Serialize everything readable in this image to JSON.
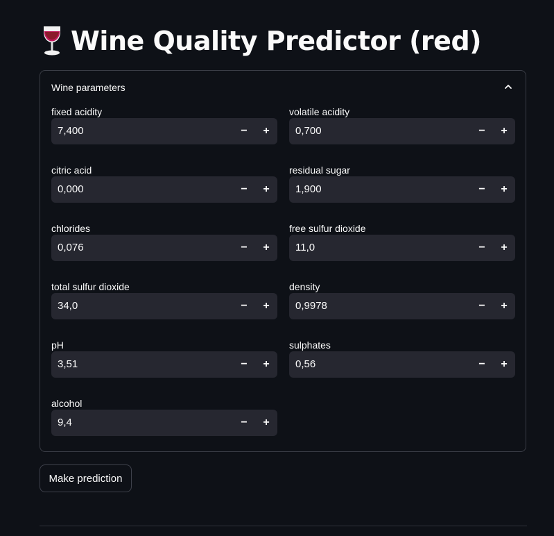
{
  "header": {
    "icon": "wine-glass-icon",
    "title": "Wine Quality Predictor (red)"
  },
  "expander": {
    "title": "Wine parameters",
    "expanded": true,
    "toggle_icon": "chevron-up-icon"
  },
  "fields": [
    {
      "label": "fixed acidity",
      "value": "7,400"
    },
    {
      "label": "volatile acidity",
      "value": "0,700"
    },
    {
      "label": "citric acid",
      "value": "0,000"
    },
    {
      "label": "residual sugar",
      "value": "1,900"
    },
    {
      "label": "chlorides",
      "value": "0,076"
    },
    {
      "label": "free sulfur dioxide",
      "value": "11,0"
    },
    {
      "label": "total sulfur dioxide",
      "value": "34,0"
    },
    {
      "label": "density",
      "value": "0,9978"
    },
    {
      "label": "pH",
      "value": "3,51"
    },
    {
      "label": "sulphates",
      "value": "0,56"
    },
    {
      "label": "alcohol",
      "value": "9,4"
    }
  ],
  "stepper": {
    "minus": "−",
    "plus": "+"
  },
  "actions": {
    "predict_label": "Make prediction"
  },
  "colors": {
    "background": "#0e1117",
    "input_bg": "#262730",
    "border": "#3a3d46",
    "text": "#fafafa",
    "wine": "#8b1a2b"
  }
}
